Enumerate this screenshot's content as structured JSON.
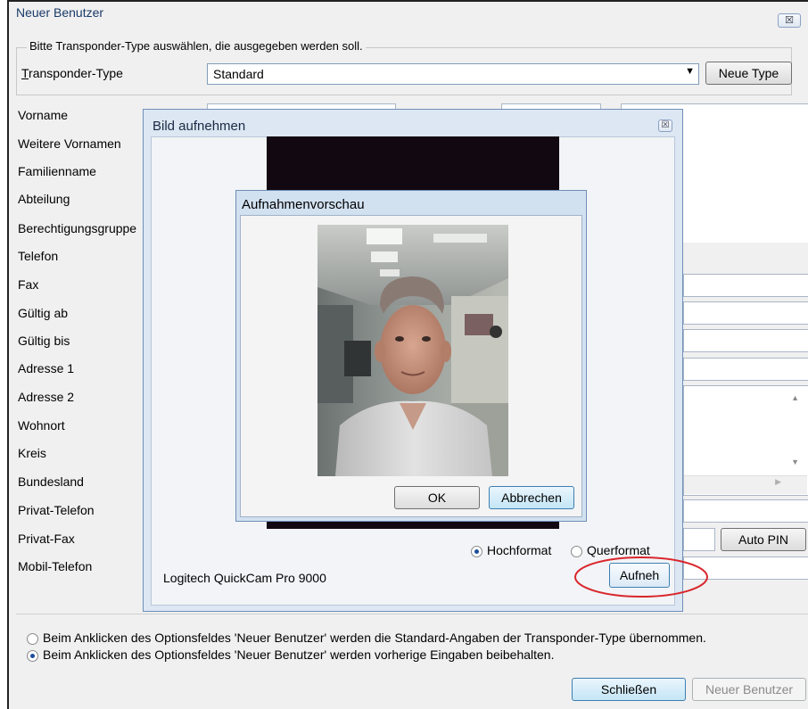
{
  "main": {
    "title": "Neuer Benutzer",
    "close_glyph": "☒",
    "group_legend": "Bitte Transponder-Type auswählen, die ausgegeben werden soll.",
    "transponder_label": "Transponder-Type",
    "transponder_value": "Standard",
    "new_type_button": "Neue Type",
    "fields": [
      "Vorname",
      "Weitere Vornamen",
      "Familienname",
      "Abteilung",
      "Berechtigungsgruppe",
      "Telefon",
      "Fax",
      "Gültig ab",
      "Gültig bis",
      "Adresse 1",
      "Adresse 2",
      "Wohnort",
      "Kreis",
      "Bundesland",
      "Privat-Telefon",
      "Privat-Fax",
      "Mobil-Telefon"
    ],
    "auto_pin_button": "Auto PIN",
    "option1": "Beim Anklicken des Optionsfeldes 'Neuer Benutzer' werden die Standard-Angaben der Transponder-Type übernommen.",
    "option2": "Beim Anklicken des Optionsfeldes 'Neuer Benutzer' werden vorherige Eingaben beibehalten.",
    "option_selected": 2,
    "close_button": "Schließen",
    "new_user_button": "Neuer Benutzer"
  },
  "bild": {
    "title": "Bild aufnehmen",
    "close_glyph": "☒",
    "orient_portrait": "Hochformat",
    "orient_landscape": "Querformat",
    "orientation_selected": "Hochformat",
    "camera": "Logitech QuickCam Pro 9000",
    "capture_button": "Aufneh"
  },
  "vorschau": {
    "title": "Aufnahmenvorschau",
    "ok_button": "OK",
    "cancel_button": "Abbrechen"
  },
  "colors": {
    "accent": "#1c4e9a",
    "highlight_circle": "#d9262c"
  }
}
